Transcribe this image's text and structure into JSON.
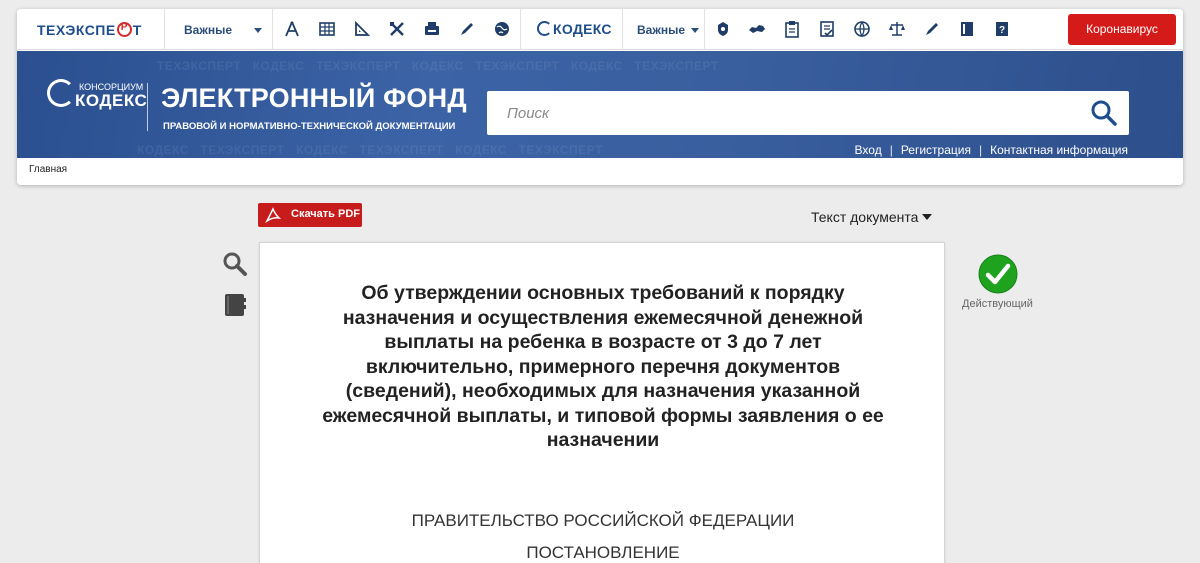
{
  "toolbar": {
    "logo_techexpert": "ТЕХЭКСПЕРТ",
    "logo_kodeks": "КОДЕКС",
    "dropdown_1": "Важные",
    "dropdown_2": "Важные",
    "corona_button": "Коронавирус",
    "left_icons": [
      "compass-icon",
      "table-icon",
      "ruler-icon",
      "tools-icon",
      "printer-icon",
      "pen-icon",
      "globe-icon"
    ],
    "right_icons": [
      "emblem-icon",
      "russia-map-icon",
      "clipboard-icon",
      "doc-check-icon",
      "globe-icon",
      "scales-icon",
      "pen-icon",
      "book-icon",
      "question-book-icon"
    ]
  },
  "banner": {
    "logo_small": "КОНСОРЦИУМ",
    "logo_big": "КОДЕКС",
    "title": "ЭЛЕКТРОННЫЙ ФОНД",
    "subtitle": "ПРАВОВОЙ И НОРМАТИВНО-ТЕХНИЧЕСКОЙ ДОКУМЕНТАЦИИ",
    "search_placeholder": "Поиск",
    "links": {
      "login": "Вход",
      "register": "Регистрация",
      "contacts": "Контактная информация"
    }
  },
  "breadcrumb": {
    "home": "Главная"
  },
  "document": {
    "pdf_button": "Скачать PDF",
    "view_select": "Текст документа",
    "title": "Об утверждении основных требований к порядку назначения и осуществления ежемесячной денежной выплаты на ребенка в возрасте от 3 до 7 лет включительно, примерного перечня документов (сведений), необходимых для назначения указанной ежемесячной выплаты, и типовой формы заявления о ее назначении",
    "organization": "ПРАВИТЕЛЬСТВО РОССИЙСКОЙ ФЕДЕРАЦИИ",
    "doc_type": "ПОСТАНОВЛЕНИЕ",
    "status": "Действующий"
  },
  "colors": {
    "brand_blue": "#2b4f8f",
    "corona_red": "#d51a1a",
    "pdf_red": "#c71c1c",
    "status_green": "#1fa31f"
  }
}
